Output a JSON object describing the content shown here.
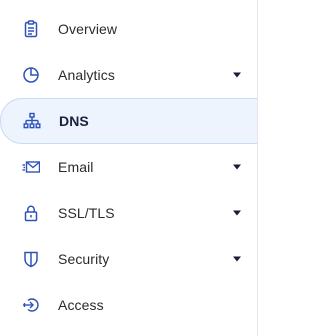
{
  "sidebar": {
    "items": [
      {
        "label": "Overview",
        "icon": "clipboard-icon",
        "has_dropdown": false
      },
      {
        "label": "Analytics",
        "icon": "pie-chart-icon",
        "has_dropdown": true
      },
      {
        "label": "DNS",
        "icon": "network-icon",
        "has_dropdown": false,
        "active": true
      },
      {
        "label": "Email",
        "icon": "envelope-icon",
        "has_dropdown": true
      },
      {
        "label": "SSL/TLS",
        "icon": "lock-icon",
        "has_dropdown": true
      },
      {
        "label": "Security",
        "icon": "shield-icon",
        "has_dropdown": true
      },
      {
        "label": "Access",
        "icon": "access-icon",
        "has_dropdown": false
      }
    ]
  },
  "colors": {
    "icon": "#2f52b8",
    "active_bg": "#eef4fd",
    "active_border": "#c9daf4",
    "caret": "#1b1b3a"
  }
}
